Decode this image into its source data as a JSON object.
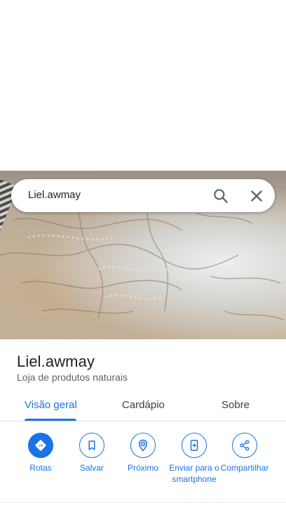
{
  "search": {
    "query": "Liel.awmay",
    "search_icon": "search-icon",
    "close_icon": "close-icon"
  },
  "place": {
    "name": "Liel.awmay",
    "category": "Loja de produtos naturais"
  },
  "tabs": [
    {
      "label": "Visão geral",
      "active": true
    },
    {
      "label": "Cardápio",
      "active": false
    },
    {
      "label": "Sobre",
      "active": false
    }
  ],
  "actions": [
    {
      "label": "Rotas",
      "icon": "directions-icon"
    },
    {
      "label": "Salvar",
      "icon": "bookmark-icon"
    },
    {
      "label": "Próximo",
      "icon": "nearby-icon"
    },
    {
      "label": "Enviar para o smartphone",
      "icon": "send-to-phone-icon"
    },
    {
      "label": "Compartilhar",
      "icon": "share-icon"
    }
  ],
  "colors": {
    "accent": "#1a73e8",
    "text_primary": "#202124",
    "text_secondary": "#5f6368"
  }
}
